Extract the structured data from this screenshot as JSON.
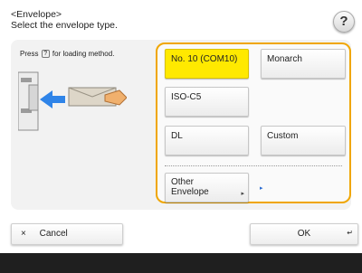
{
  "header": {
    "line1": "<Envelope>",
    "line2": "Select the envelope type."
  },
  "help": {
    "label": "?"
  },
  "hint": {
    "prefix": "Press",
    "badge": "?",
    "suffix": "for loading method."
  },
  "options": [
    {
      "label": "No. 10 (COM10)",
      "selected": true
    },
    {
      "label": "Monarch",
      "selected": false
    },
    {
      "label": "ISO-C5",
      "selected": false
    },
    {
      "label": "DL",
      "selected": false
    },
    {
      "label": "Custom",
      "selected": false
    },
    {
      "label_line1": "Other",
      "label_line2": "Envelope",
      "selected": false
    }
  ],
  "other_extra_mark": "▸",
  "footer": {
    "cancel_icon": "×",
    "cancel_label": "Cancel",
    "ok_label": "OK"
  },
  "colors": {
    "selected": "#ffe900",
    "frame": "#f0a600"
  }
}
